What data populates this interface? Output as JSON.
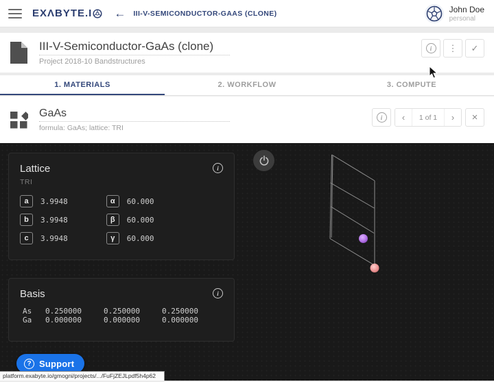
{
  "header": {
    "logo_text": "EXΛBYTE.I",
    "breadcrumb": "III-V-SEMICONDUCTOR-GAAS (CLONE)",
    "user": {
      "name": "John Doe",
      "account": "personal"
    }
  },
  "title_card": {
    "title": "III-V-Semiconductor-GaAs (clone)",
    "subtitle": "Project 2018-10 Bandstructures"
  },
  "tabs": [
    {
      "label": "1. MATERIALS",
      "active": true
    },
    {
      "label": "2. WORKFLOW",
      "active": false
    },
    {
      "label": "3. COMPUTE",
      "active": false
    }
  ],
  "material_card": {
    "title": "GaAs",
    "subtitle": "formula: GaAs; lattice: TRI",
    "pager": "1 of 1"
  },
  "lattice": {
    "title": "Lattice",
    "type": "TRI",
    "params": [
      {
        "label": "a",
        "value": "3.9948"
      },
      {
        "label": "b",
        "value": "3.9948"
      },
      {
        "label": "c",
        "value": "3.9948"
      },
      {
        "label": "α",
        "value": "60.000"
      },
      {
        "label": "β",
        "value": "60.000"
      },
      {
        "label": "γ",
        "value": "60.000"
      }
    ]
  },
  "basis": {
    "title": "Basis",
    "atoms": [
      {
        "element": "As",
        "x": "0.250000",
        "y": "0.250000",
        "z": "0.250000"
      },
      {
        "element": "Ga",
        "x": "0.000000",
        "y": "0.000000",
        "z": "0.000000"
      }
    ]
  },
  "viewer": {
    "atom_colors": {
      "As": "#b678e8",
      "Ga": "#ef9a9a"
    },
    "wireframe_color": "#9b9b9b"
  },
  "support": {
    "label": "Support"
  },
  "status_bar": {
    "url": "platform.exabyte.io/gmogni/projects/.../FuFjZEJLpdf5h4p62"
  },
  "icons": {
    "info": "i",
    "kebab": "⋮",
    "check": "✓",
    "chevron_left": "‹",
    "chevron_right": "›",
    "close": "×",
    "back": "←",
    "question": "?"
  },
  "colors": {
    "brand_navy": "#2c3e70",
    "tab_active": "#33477a",
    "accent_blue": "#1a73e8",
    "dark_bg": "#191919",
    "panel_bg": "#1e1e1e"
  }
}
